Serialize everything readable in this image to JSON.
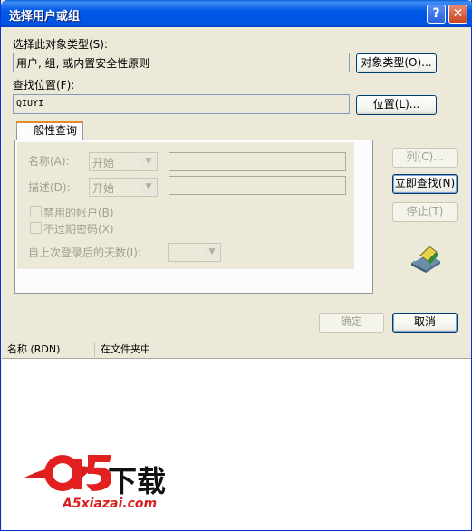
{
  "window": {
    "title": "选择用户或组"
  },
  "object_types": {
    "label": "选择此对象类型(S):",
    "value": "用户, 组, 或内置安全性原则",
    "button": "对象类型(O)..."
  },
  "location": {
    "label": "查找位置(F):",
    "value": "QIUYI",
    "button": "位置(L)..."
  },
  "tab": {
    "label": "一般性查询"
  },
  "query": {
    "name_label": "名称(A):",
    "name_mode": "开始",
    "desc_label": "描述(D):",
    "desc_mode": "开始",
    "disabled_accounts": "禁用的帐户(B)",
    "non_expiring": "不过期密码(X)",
    "days_label": "自上次登录后的天数(I):"
  },
  "buttons": {
    "columns": "列(C)...",
    "find_now": "立即查找(N)",
    "stop": "停止(T)",
    "ok": "确定",
    "cancel": "取消"
  },
  "results": {
    "columns": [
      "名称 (RDN)",
      "在文件夹中"
    ]
  },
  "watermark": {
    "brand": "a5",
    "brand_cn": "下载",
    "url": "A5xiazai.com"
  }
}
